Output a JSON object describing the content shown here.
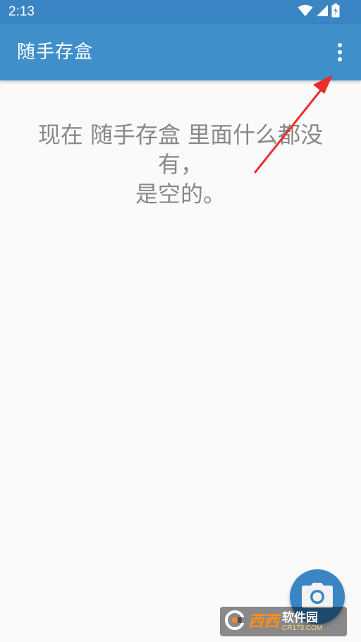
{
  "status_bar": {
    "time": "2:13",
    "icons": [
      "wifi-icon",
      "signal-icon",
      "battery-charging-icon"
    ]
  },
  "app_bar": {
    "title": "随手存盒",
    "overflow_menu_icon": "more-vert-icon"
  },
  "empty_state": {
    "lines": [
      "现在 随手存盒 里面什么都没",
      "有，",
      "是空的。"
    ]
  },
  "fab": {
    "icon": "camera-icon"
  },
  "annotation": {
    "arrow_color": "#ee2b2b"
  },
  "watermark": {
    "logo_text": "西西",
    "main_text": "软件园",
    "sub_text": "CR173.COM"
  },
  "colors": {
    "primary": "#3f8fca",
    "primary_dark": "#3a86c4",
    "background": "#fafafa",
    "empty_text": "#888888"
  }
}
